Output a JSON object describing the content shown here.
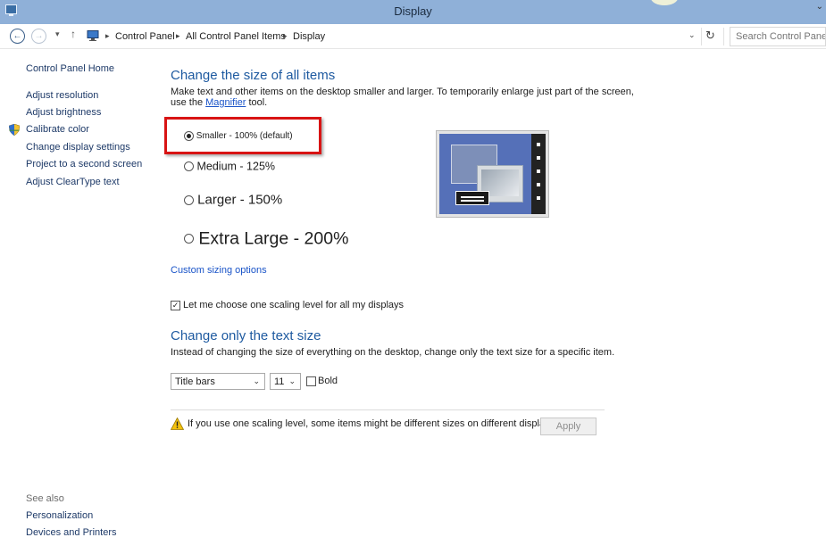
{
  "window": {
    "title": "Display"
  },
  "address": {
    "breadcrumbs": [
      "Control Panel",
      "All Control Panel Items",
      "Display"
    ],
    "search_placeholder": "Search Control Panel"
  },
  "sidebar": {
    "home": "Control Panel Home",
    "links": [
      "Adjust resolution",
      "Adjust brightness",
      "Calibrate color",
      "Change display settings",
      "Project to a second screen",
      "Adjust ClearType text"
    ],
    "see_also_label": "See also",
    "see_also": [
      "Personalization",
      "Devices and Printers"
    ]
  },
  "size_section": {
    "heading": "Change the size of all items",
    "desc_line1": "Make text and other items on the desktop smaller and larger. To temporarily enlarge just part of the screen,",
    "desc_prefix": "use the ",
    "desc_link": "Magnifier",
    "desc_suffix": " tool.",
    "options": [
      {
        "label": "Smaller - 100% (default)",
        "checked": true
      },
      {
        "label": "Medium - 125%",
        "checked": false
      },
      {
        "label": "Larger - 150%",
        "checked": false
      },
      {
        "label": "Extra Large - 200%",
        "checked": false
      }
    ],
    "custom_link": "Custom sizing options",
    "scaling_checkbox": {
      "label": "Let me choose one scaling level for all my displays",
      "checked": true
    }
  },
  "text_section": {
    "heading": "Change only the text size",
    "desc": "Instead of changing the size of everything on the desktop, change only the text size for a specific item.",
    "item_select": "Title bars",
    "size_select": "11",
    "bold_label": "Bold"
  },
  "footer": {
    "warning": "If you use one scaling level, some items might be different sizes on different displays.",
    "apply_label": "Apply"
  }
}
